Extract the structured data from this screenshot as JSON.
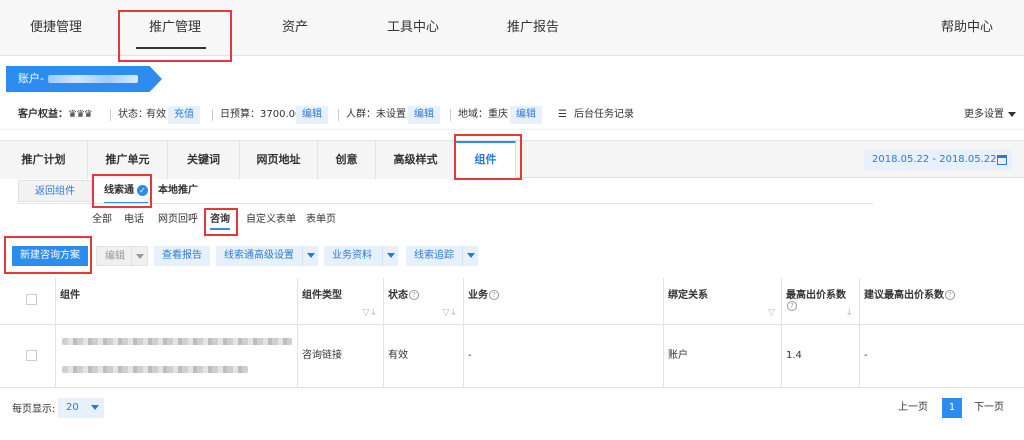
{
  "topnav": {
    "items": [
      "便捷管理",
      "推广管理",
      "资产",
      "工具中心",
      "推广报告"
    ],
    "help": "帮助中心"
  },
  "account": {
    "label": "账户-"
  },
  "info": {
    "rights_label": "客户权益：",
    "status_label": "状态：",
    "status_value": "有效",
    "recharge": "充值",
    "budget_label": "日预算：3700.00",
    "edit": "编辑",
    "crowd_label": "人群：未设置",
    "region_label": "地域：重庆",
    "task_log": "后台任务记录",
    "more_settings": "更多设置"
  },
  "module_tabs": [
    "推广计划",
    "推广单元",
    "关键词",
    "网页地址",
    "创意",
    "高级样式",
    "组件"
  ],
  "date_range": "2018.05.22 - 2018.05.22",
  "subtabs": {
    "return": "返回组件",
    "clue": "线索通",
    "local": "本地推广"
  },
  "filters": [
    "全部",
    "电话",
    "网页回呼",
    "咨询",
    "自定义表单",
    "表单页"
  ],
  "toolbar": {
    "new_plan": "新建咨询方案",
    "edit": "编辑",
    "view_report": "查看报告",
    "advanced": "线索通高级设置",
    "business": "业务资料",
    "tracking": "线索追踪"
  },
  "table": {
    "headers": [
      "组件",
      "组件类型",
      "状态",
      "业务",
      "绑定关系",
      "最高出价系数",
      "建议最高出价系数"
    ],
    "row": {
      "type": "咨询链接",
      "status": "有效",
      "business": "-",
      "binding": "账户",
      "max_coef": "1.4",
      "suggested": "-"
    }
  },
  "footer": {
    "page_size_label": "每页显示:",
    "page_size": "20",
    "prev": "上一页",
    "current": "1",
    "next": "下一页"
  },
  "colors": {
    "accent": "#2d8cf0",
    "highlight_box": "#e53935",
    "status_green": "#3aa047"
  }
}
